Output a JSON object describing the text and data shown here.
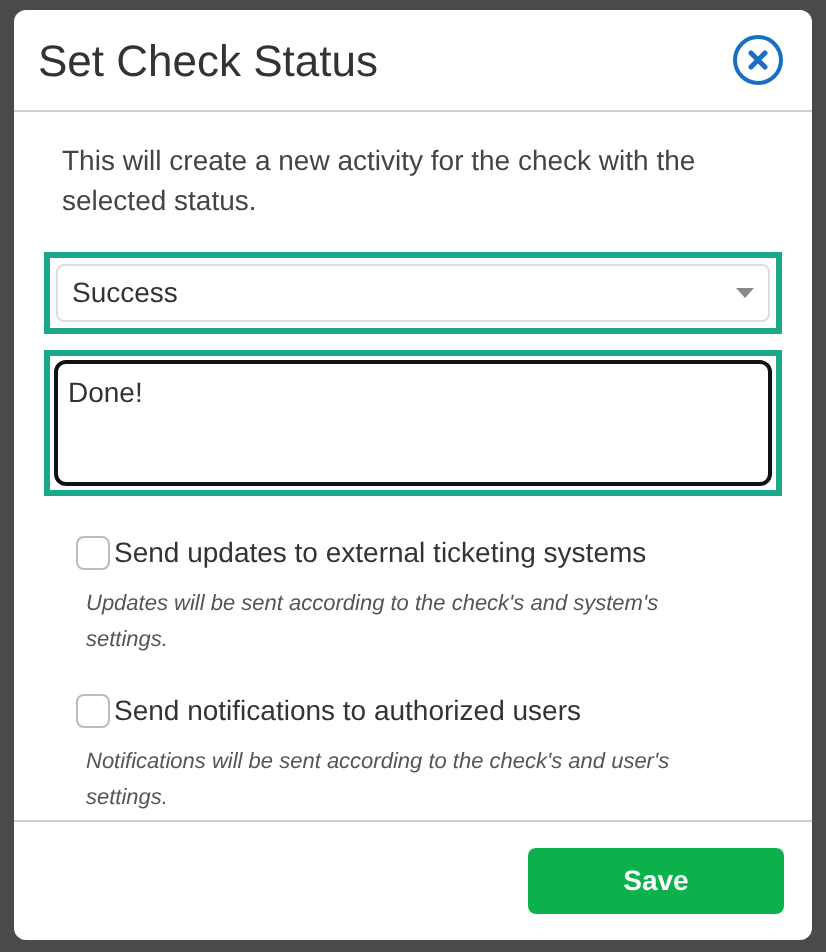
{
  "dialog": {
    "title": "Set Check Status",
    "description": "This will create a new activity for the check with the selected status.",
    "status_select": {
      "value": "Success",
      "highlighted": true
    },
    "comment": {
      "value": "Done!",
      "highlighted": true
    },
    "options": [
      {
        "label": "Send updates to external ticketing systems",
        "checked": false,
        "hint": "Updates will be sent according to the check's and system's settings."
      },
      {
        "label": "Send notifications to authorized users",
        "checked": false,
        "hint": "Notifications will be sent according to the check's and user's settings."
      }
    ],
    "buttons": [
      {
        "label": "Save"
      }
    ]
  }
}
